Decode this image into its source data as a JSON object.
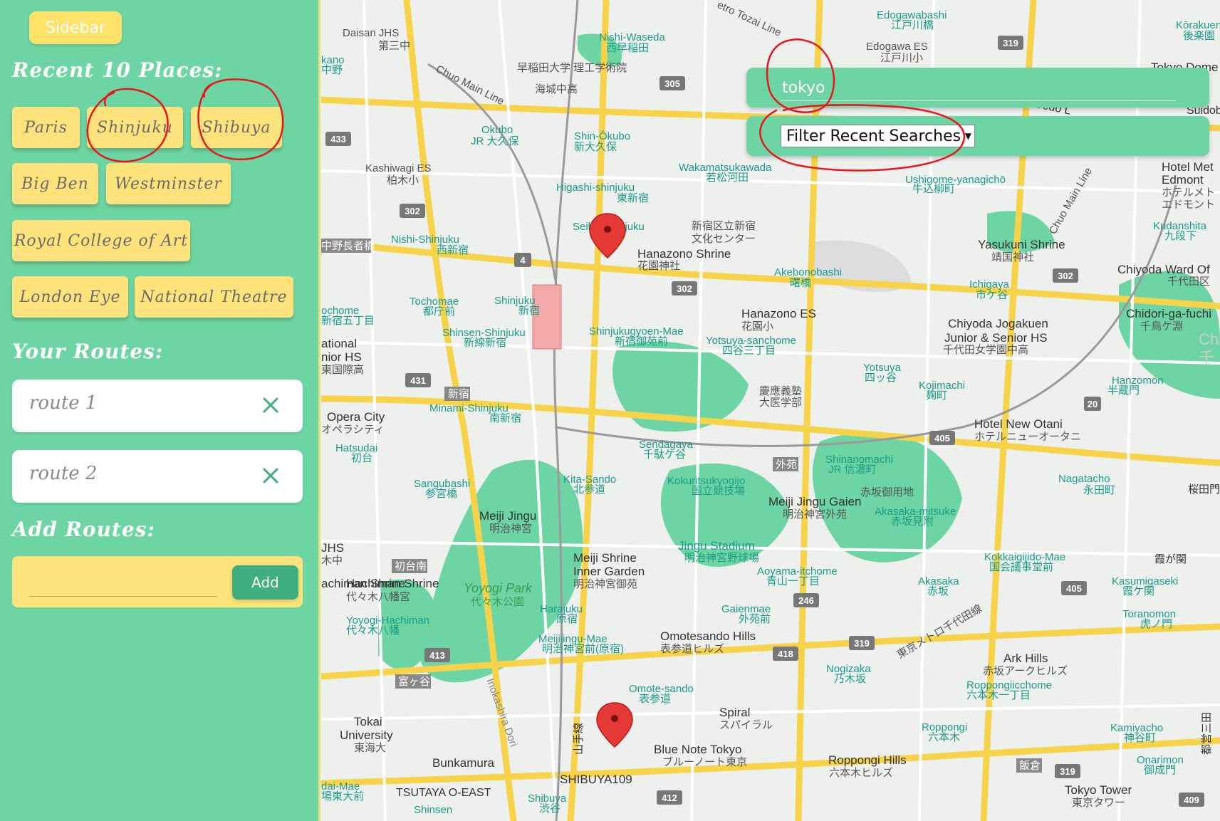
{
  "sidebar": {
    "toggle_label": "Sidebar",
    "recent_title": "Recent 10 Places:",
    "recent_places": [
      "Paris",
      "Shinjuku",
      "Shibuya",
      "Big Ben",
      "Westminster",
      "Royal College of Art",
      "London Eye",
      "National Theatre"
    ],
    "routes_title": "Your Routes:",
    "routes": [
      "route 1",
      "route 2"
    ],
    "add_title": "Add Routes:",
    "add_input_value": "",
    "add_button_label": "Add"
  },
  "search": {
    "value": "tokyo",
    "filter_label": "Filter Recent Searches"
  },
  "colors": {
    "sidebar_bg": "#6dd5a4",
    "chip_bg": "#fee27b",
    "add_button": "#3fb07d",
    "annotation_red": "#e8161b"
  },
  "map": {
    "labels": {
      "l0": "Daisan JHS",
      "l1": "第三中",
      "l2": "Nishi-Waseda",
      "l3": "西早稲田",
      "l4": "早稲田大学 理工学術院",
      "l5": "海城中高",
      "l6": "Edogawabashi",
      "l7": "江戸川橋",
      "l8": "Edogawa ES",
      "l9": "江戸川小",
      "l10": "Kōrakuen",
      "l11": "後楽園",
      "l12": "Chuo Main Line",
      "l13": "Okubo",
      "l14": "JR 大久保",
      "l15": "Shin-Ōkubo",
      "l16": "新大久保",
      "l17": "Kashiwagi ES",
      "l18": "柏木小",
      "l19": "Wakamatsukawada",
      "l20": "若松河田",
      "l21": "Ushigome-yanagichō",
      "l22": "牛込柳町",
      "l23": "Higashi-shinjuku",
      "l24": "東新宿",
      "l25": "Seibu-Shinjuku",
      "l26": "新宿区立新宿",
      "l27": "文化センター",
      "l28": "Hanazono Shrine",
      "l29": "花園神社",
      "l30": "Nishi-Shinjuku",
      "l31": "西新宿",
      "l32": "中野長者橋",
      "l33": "Akebonobashi",
      "l34": "曙橋",
      "l35": "Yasukuni Shrine",
      "l36": "靖国神社",
      "l37": "Chiyoda Ward Of",
      "l38": "千代田区",
      "l39": "Tochomae",
      "l40": "都庁前",
      "l41": "Shinjuku",
      "l42": "新宿",
      "l43": "Hanazono ES",
      "l44": "花園小",
      "l45": "Ichigaya",
      "l46": "市ケ谷",
      "l47": "Chidori-ga-fuchi",
      "l48": "千鳥ケ淵",
      "l49": "Shinsen-Shinjuku",
      "l50": "新線新宿",
      "l51": "Shinjukugyoen-Mae",
      "l52": "新宿御苑前",
      "l53": "Yotsuya-sanchome",
      "l54": "四谷三丁目",
      "l55": "Chiyoda Jogakuen",
      "l56": "Junior & Senior HS",
      "l57": "千代田女学園中高",
      "l58": "Yotsuya",
      "l59": "四ッ谷",
      "l60": "Kojimachi",
      "l61": "麹町",
      "l62": "Hanzomon",
      "l63": "半蔵門",
      "l64": "新宿",
      "l65": "慶應義塾",
      "l66": "大医学部",
      "l67": "Opera City",
      "l68": "オペラシティ",
      "l69": "Minami-Shinjuku",
      "l70": "南新宿",
      "l71": "Hotel New Otani",
      "l72": "ホテルニューオータニ",
      "l73": "Hatsudai",
      "l74": "初台",
      "l75": "Sendagaya",
      "l76": "千駄ケ谷",
      "l77": "外苑",
      "l78": "Shinanomachi",
      "l79": "JR 信濃町",
      "l80": "Sangubashi",
      "l81": "参宮橋",
      "l82": "Kita-Sando",
      "l83": "北参道",
      "l84": "Kokuritsukyogijo",
      "l85": "国立競技場",
      "l86": "Meiji Jingu Gaien",
      "l87": "明治神宮外苑",
      "l88": "赤坂御用地",
      "l89": "Nagatacho",
      "l90": "永田町",
      "l91": "Meiji Jingu",
      "l92": "明治神宮",
      "l93": "Akasaka-mitsuke",
      "l94": "赤坂見附",
      "l95": "Jingu Stadium",
      "l96": "明治神宮野球場",
      "l97": "Meiji Shrine",
      "l98": "Inner Garden",
      "l99": "明治神宮御苑",
      "l100": "初台南",
      "l101": "Hachiman Shrine",
      "l102": "代々木八幡宮",
      "l103": "Yoyogi Park",
      "l104": "代々木公園",
      "l105": "Aoyama-itchome",
      "l106": "青山一丁目",
      "l107": "Kokkaigijido-Mae",
      "l108": "国会議事堂前",
      "l109": "Akasaka",
      "l110": "赤坂",
      "l111": "Kasumigaseki",
      "l112": "霞ケ関",
      "l113": "Harajuku",
      "l114": "原宿",
      "l115": "Gaienmae",
      "l116": "外苑前",
      "l117": "Yoyogi-Hachiman",
      "l118": "代々木八幡",
      "l119": "Meijijingu-Mae",
      "l120": "明治神宮前(原宿)",
      "l121": "Omotesando Hills",
      "l122": "表参道ヒルズ",
      "l123": "東京メトロ千代田線",
      "l124": "Ark Hills",
      "l125": "赤坂アークヒルズ",
      "l126": "Toranomon",
      "l127": "虎ノ門",
      "l128": "Nogizaka",
      "l129": "乃木坂",
      "l130": "Roppongiicchome",
      "l131": "六本木一丁目",
      "l132": "富ヶ谷",
      "l133": "Omote-sando",
      "l134": "表参道",
      "l135": "Tokai",
      "l136": "University",
      "l137": "東海大",
      "l138": "Spiral",
      "l139": "スパイラル",
      "l140": "Roppongi",
      "l141": "六本木",
      "l142": "Kamiyacho",
      "l143": "神谷町",
      "l144": "Blue Note Tokyo",
      "l145": "ブルーノート東京",
      "l146": "Bunkamura",
      "l147": "Roppongi Hills",
      "l148": "六本木ヒルズ",
      "l149": "飯倉",
      "l150": "Onarimon",
      "l151": "御成門",
      "l152": "SHIBUYA109",
      "l153": "TSUTAYA O-EAST",
      "l154": "Shibuya",
      "l155": "渋谷",
      "l156": "Tokyo Tower",
      "l157": "東京タワー",
      "l158": "山手線",
      "l159": "Inokashira Dori",
      "l160": "Hotel Met",
      "l161": "Edmont",
      "l162": "ホテルメト",
      "l163": "エドモント",
      "l164": "Kudanshita",
      "l165": "九段下",
      "l166": "Chuo Main Line",
      "l167": "etro Tozai Line",
      "l168": "Tokyo Dome",
      "l169": "kano",
      "l170": "中野",
      "l171": "ochome",
      "l172": "新宿五丁目",
      "l173": "ational",
      "l174": "nior HS",
      "l175": "東国際高",
      "l176": "JHS",
      "l177": "木中",
      "l178": "achiman Shrine",
      "l179": "dai-Mae",
      "l180": "場東大前",
      "l181": "Shinsen",
      "l182": "Oedo L",
      "l183": "Suidob",
      "l184": "桜田門",
      "l185": "霞が関",
      "l186": "Chi",
      "l187": "千",
      "l188": "都営三田"
    },
    "roads": {
      "r433": "433",
      "r302a": "302",
      "r4": "4",
      "r302b": "302",
      "r431": "431",
      "r305": "305",
      "r319a": "319",
      "r319b": "319",
      "r246": "246",
      "r418": "418",
      "r413": "413",
      "r412": "412",
      "r405a": "405",
      "r405b": "405",
      "r20": "20",
      "r302c": "302",
      "r319c": "319",
      "r409": "409"
    }
  }
}
